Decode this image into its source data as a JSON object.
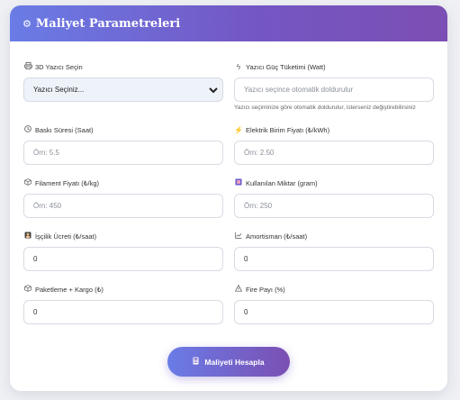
{
  "header": {
    "icon": "gear-icon",
    "title": "Maliyet Parametreleri"
  },
  "fields": {
    "printer": {
      "icon": "printer-icon",
      "label": "3D Yazıcı Seçin",
      "selected": "Yazıcı Seçiniz..."
    },
    "power": {
      "icon": "plug-icon",
      "label": "Yazıcı Güç Tüketimi (Watt)",
      "placeholder": "Yazıcı seçince otomatik doldurulur",
      "hint": "Yazıcı seçiminize göre otomatik doldurulur, isterseniz değiştirebilirsiniz"
    },
    "print_time": {
      "icon": "clock-icon",
      "label": "Baskı Süresi (Saat)",
      "placeholder": "Örn: 5.5"
    },
    "electricity_price": {
      "icon": "bolt-icon",
      "label": "Elektrik Birim Fiyatı (₺/kWh)",
      "placeholder": "Örn: 2.50"
    },
    "filament_price": {
      "icon": "box-icon",
      "label": "Filament Fiyatı (₺/kg)",
      "placeholder": "Örn: 450"
    },
    "used_amount": {
      "icon": "scale-icon",
      "label": "Kullanılan Miktar (gram)",
      "placeholder": "Örn: 250"
    },
    "labor_cost": {
      "icon": "worker-icon",
      "label": "İşçilik Ücreti (₺/saat)",
      "value": "0"
    },
    "depreciation": {
      "icon": "chart-icon",
      "label": "Amortisman (₺/saat)",
      "value": "0"
    },
    "packaging": {
      "icon": "package-icon",
      "label": "Paketleme + Kargo (₺)",
      "value": "0"
    },
    "waste": {
      "icon": "warning-icon",
      "label": "Fire Payı (%)",
      "value": "0"
    }
  },
  "button": {
    "icon": "calculator-icon",
    "label": "Maliyeti Hesapla"
  }
}
